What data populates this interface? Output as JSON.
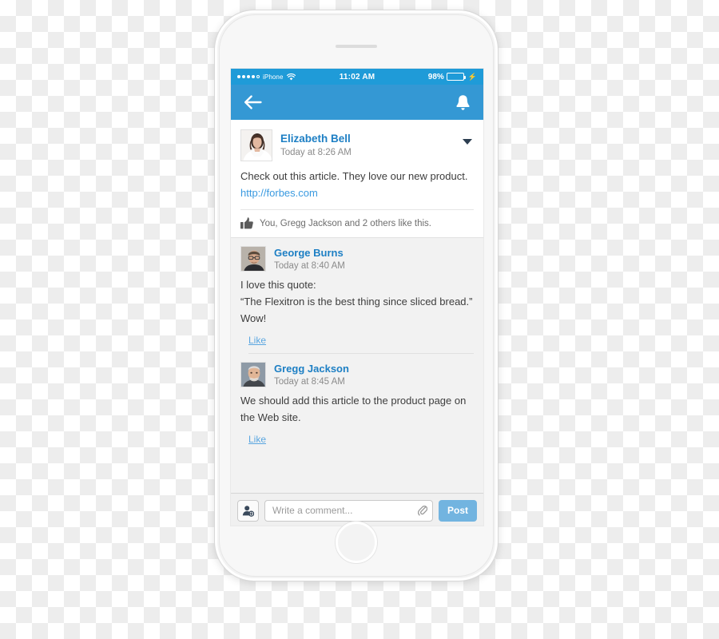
{
  "device": {
    "name": "iphone-mockup",
    "status_bar": {
      "carrier": "iPhone",
      "signal_dots_filled": 4,
      "signal_dots_empty": 1,
      "wifi_icon": "wifi-icon",
      "time": "11:02 AM",
      "battery_percent": "98%",
      "battery_level": 98,
      "charging": true,
      "bolt_icon": "lightning-bolt-icon"
    }
  },
  "navbar": {
    "back_icon": "back-arrow-icon",
    "notification_icon": "bell-icon",
    "background": "#3498d4"
  },
  "post": {
    "author": "Elizabeth Bell",
    "timestamp": "Today at 8:26 AM",
    "avatar_icon": "avatar-elizabeth-bell",
    "menu_icon": "chevron-down-icon",
    "text_before_link": "Check out this article. They love our new product. ",
    "link_text": "http://forbes.com",
    "likes": {
      "icon": "thumbs-up-icon",
      "text": "You, Gregg Jackson and 2 others like this."
    }
  },
  "comments": [
    {
      "author": "George Burns",
      "timestamp": "Today at 8:40 AM",
      "avatar_icon": "avatar-george-burns",
      "text": "I love this quote:\n“The Flexitron is the best thing since sliced bread.” Wow!",
      "like_label": "Like"
    },
    {
      "author": "Gregg Jackson",
      "timestamp": "Today at 8:45 AM",
      "avatar_icon": "avatar-gregg-jackson",
      "text": "We should add this article to the product page on the Web site.",
      "like_label": "Like"
    }
  ],
  "composer": {
    "mention_icon": "add-person-icon",
    "placeholder": "Write a comment...",
    "value": "",
    "attach_icon": "paperclip-icon",
    "post_label": "Post"
  },
  "colors": {
    "nav_blue": "#3498d4",
    "status_blue": "#1f9bd8",
    "link_blue": "#1d7fc4",
    "url_blue": "#3a9ae0",
    "post_button": "#72b4e0",
    "battery_green": "#4cd964",
    "comment_bg": "#f2f2f2"
  }
}
